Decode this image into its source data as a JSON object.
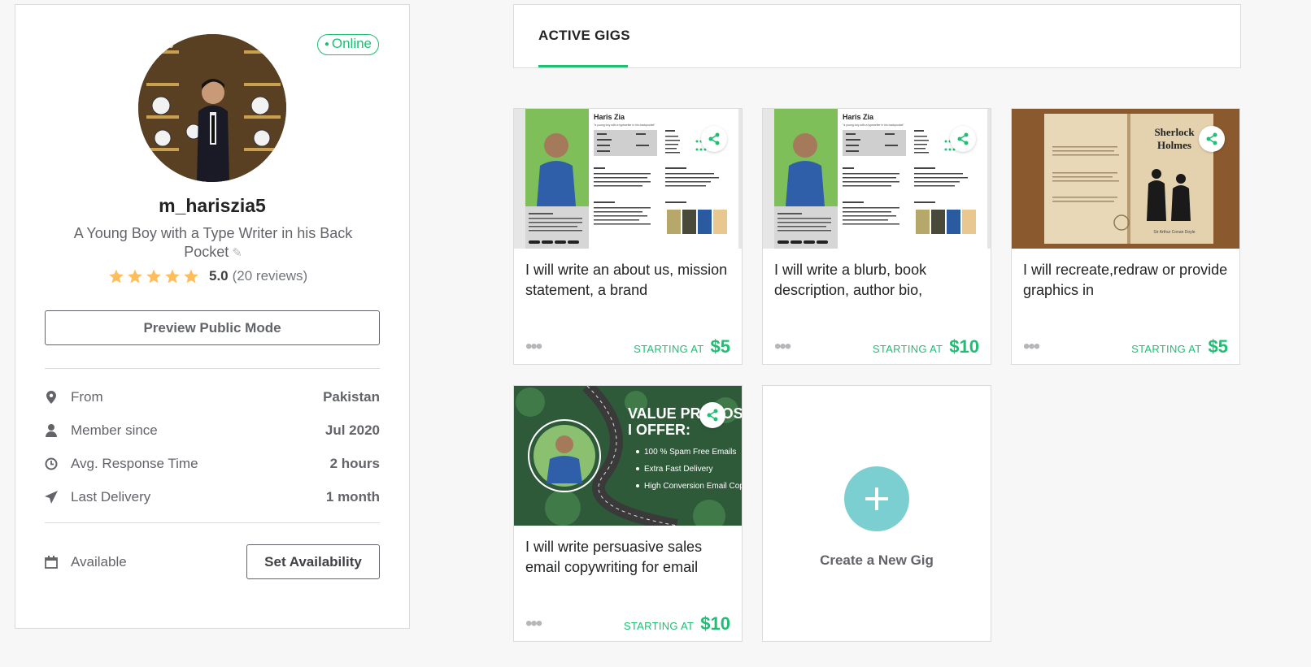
{
  "profile": {
    "status": "Online",
    "username": "m_hariszia5",
    "tagline_line1": "A Young Boy with a Type Writer in his Back",
    "tagline_line2": "Pocket",
    "rating_value": "5.0",
    "rating_count": "(20 reviews)",
    "stars": 5,
    "preview_button": "Preview Public Mode",
    "info": [
      {
        "icon": "location-pin-icon",
        "label": "From",
        "value": "Pakistan"
      },
      {
        "icon": "user-icon",
        "label": "Member since",
        "value": "Jul 2020"
      },
      {
        "icon": "clock-icon",
        "label": "Avg. Response Time",
        "value": "2 hours"
      },
      {
        "icon": "paper-plane-icon",
        "label": "Last Delivery",
        "value": "1 month"
      }
    ],
    "availability_label": "Available",
    "set_availability_button": "Set Availability"
  },
  "tabs": {
    "active": "ACTIVE GIGS"
  },
  "gigs": [
    {
      "title": "I will write an about us, mission statement, a brand",
      "starting_label": "STARTING AT",
      "price": "$5",
      "thumb_name": "Haris Zia",
      "thumb_sub": "\"a young boy with a typewriter in his backpocket\""
    },
    {
      "title": "I will write a blurb, book description, author bio,",
      "starting_label": "STARTING AT",
      "price": "$10",
      "thumb_name": "Haris Zia",
      "thumb_sub": "\"a young boy with a typewriter in his backpocket\""
    },
    {
      "title": "I will recreate,redraw or provide graphics in",
      "starting_label": "STARTING AT",
      "price": "$5",
      "thumb_title_1": "Sherlock",
      "thumb_title_2": "Holmes",
      "thumb_author": "Sir Arthur Conan Doyle"
    },
    {
      "title": "I will write persuasive sales email copywriting for email",
      "starting_label": "STARTING AT",
      "price": "$10",
      "thumb_head_1": "VALUE PROPOSITION",
      "thumb_head_2": "I OFFER:",
      "thumb_points": [
        "100 % Spam Free Emails",
        "Extra Fast Delivery",
        "High Conversion Email Copy"
      ]
    }
  ],
  "create_gig": {
    "label": "Create a New Gig"
  },
  "colors": {
    "brand_green": "#1dbf73",
    "star_yellow": "#ffbe5b",
    "plus_teal": "#7ccfd1"
  }
}
